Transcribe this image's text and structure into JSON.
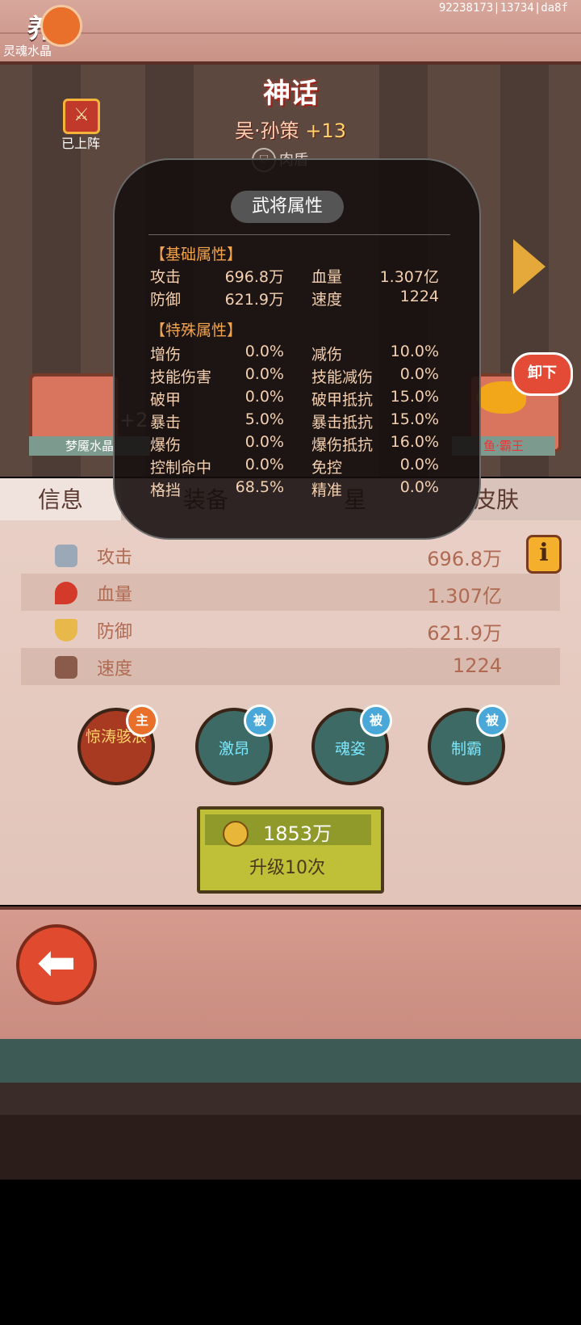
{
  "header": {
    "title": "养成",
    "debug_id": "92238173|13734|da8f"
  },
  "hero": {
    "rarity": "神话",
    "name": "吴·孙策",
    "plus": "+13",
    "role": "肉盾",
    "deployed_label": "已上阵"
  },
  "equipment": {
    "left_name": "灵魂水晶",
    "left_plus": "+2",
    "left_footer": "梦魇水晶",
    "right_footer": "鱼·霸王",
    "unequip_label": "卸下"
  },
  "tabs": [
    "信息",
    "装备",
    "星",
    "皮肤"
  ],
  "stats": [
    {
      "icon": "sword-icon",
      "label": "攻击",
      "value": "696.8万"
    },
    {
      "icon": "blood-drop-icon",
      "label": "血量",
      "value": "1.307亿"
    },
    {
      "icon": "shield-icon",
      "label": "防御",
      "value": "621.9万"
    },
    {
      "icon": "wing-boot-icon",
      "label": "速度",
      "value": "1224"
    }
  ],
  "skills": [
    {
      "label": "惊涛骇浪",
      "badge": "主"
    },
    {
      "label": "激昂",
      "badge": "被"
    },
    {
      "label": "魂姿",
      "badge": "被"
    },
    {
      "label": "制霸",
      "badge": "被"
    }
  ],
  "upgrade": {
    "cost": "1853万",
    "label": "升级10次"
  },
  "overlay": {
    "title": "武将属性",
    "basic_title": "【基础属性】",
    "basic": [
      {
        "k1": "攻击",
        "v1": "696.8万",
        "k2": "血量",
        "v2": "1.307亿"
      },
      {
        "k1": "防御",
        "v1": "621.9万",
        "k2": "速度",
        "v2": "1224"
      }
    ],
    "special_title": "【特殊属性】",
    "special": [
      {
        "k1": "增伤",
        "v1": "0.0%",
        "k2": "减伤",
        "v2": "10.0%"
      },
      {
        "k1": "技能伤害",
        "v1": "0.0%",
        "k2": "技能减伤",
        "v2": "0.0%"
      },
      {
        "k1": "破甲",
        "v1": "0.0%",
        "k2": "破甲抵抗",
        "v2": "15.0%"
      },
      {
        "k1": "暴击",
        "v1": "5.0%",
        "k2": "暴击抵抗",
        "v2": "15.0%"
      },
      {
        "k1": "爆伤",
        "v1": "0.0%",
        "k2": "爆伤抵抗",
        "v2": "16.0%"
      },
      {
        "k1": "控制命中",
        "v1": "0.0%",
        "k2": "免控",
        "v2": "0.0%"
      },
      {
        "k1": "格挡",
        "v1": "68.5%",
        "k2": "精准",
        "v2": "0.0%"
      }
    ]
  }
}
